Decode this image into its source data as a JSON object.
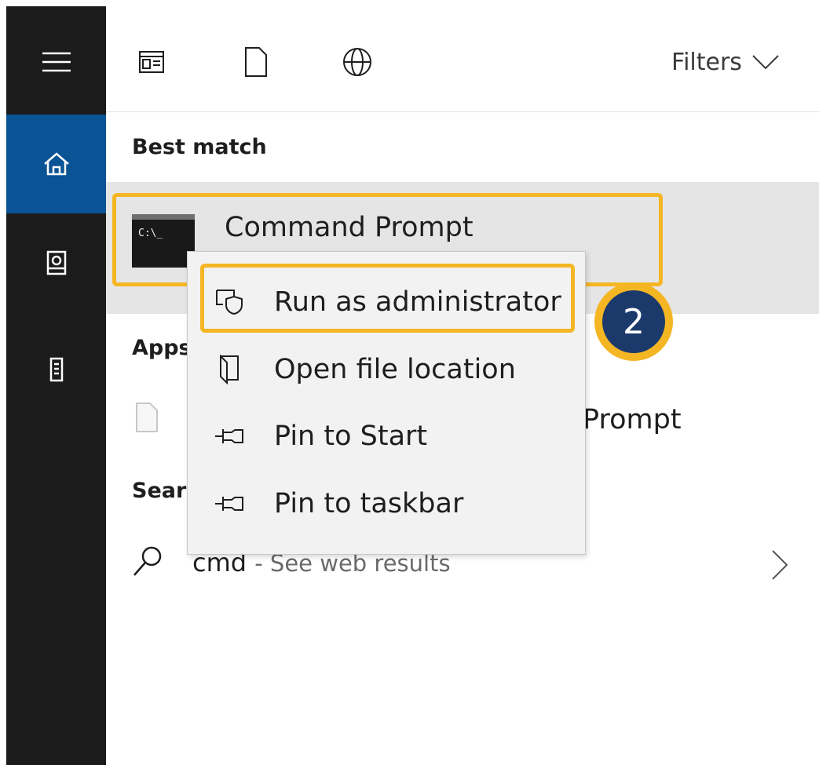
{
  "toolbar": {
    "filters_label": "Filters",
    "icons": [
      "apps-icon",
      "documents-icon",
      "web-icon"
    ]
  },
  "rail": {
    "items": [
      "hamburger-menu-icon",
      "home-icon",
      "notebook-icon",
      "device-icon"
    ],
    "active": "home-icon",
    "active_color": "#0a5394"
  },
  "sections": {
    "best_match": "Best match",
    "apps": "Apps",
    "search_web": "Sear"
  },
  "best_match_item": {
    "title": "Command Prompt",
    "icon_text": "C:\\_"
  },
  "apps_item": {
    "title_visible": "Prompt"
  },
  "web_item": {
    "query": "cmd",
    "suffix": "- See web results"
  },
  "context_menu": {
    "items": [
      {
        "label": "Run as administrator",
        "icon": "admin-shield-icon"
      },
      {
        "label": "Open file location",
        "icon": "file-location-icon"
      },
      {
        "label": "Pin to Start",
        "icon": "pin-icon"
      },
      {
        "label": "Pin to taskbar",
        "icon": "pin-icon"
      }
    ]
  },
  "step_badge": {
    "number": "2",
    "ring_color": "#f5b624",
    "fill_color": "#1b3a6b"
  }
}
